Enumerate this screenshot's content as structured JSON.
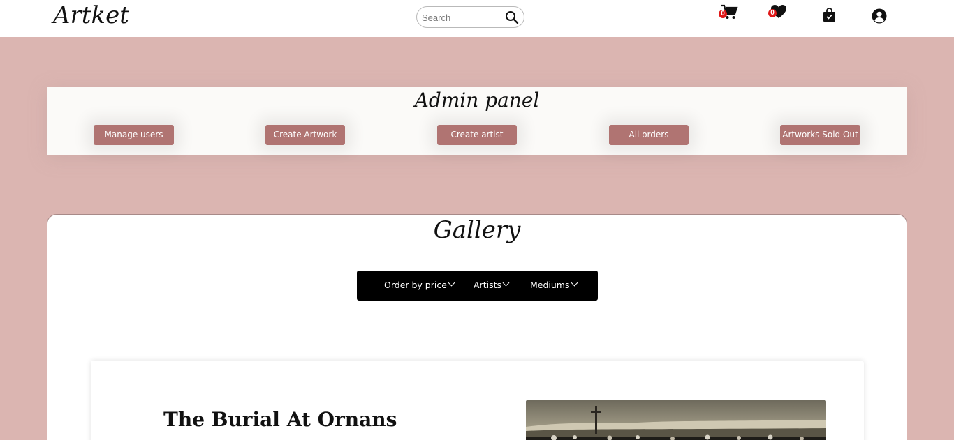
{
  "header": {
    "logo": "Artket",
    "search": {
      "placeholder": "Search",
      "value": ""
    },
    "cart_count": "0",
    "wishlist_count": "0"
  },
  "admin_panel": {
    "title": "Admin panel",
    "buttons": [
      "Manage users",
      "Create Artwork",
      "Create artist",
      "All orders",
      "Artworks Sold Out"
    ]
  },
  "gallery": {
    "title": "Gallery",
    "filters": [
      "Order by price",
      "Artists",
      "Mediums"
    ],
    "artwork": {
      "title": "The Burial At Ornans"
    }
  },
  "colors": {
    "page_background": "#dbb5b1",
    "admin_button": "#b07472",
    "filter_bar": "#000000",
    "badge": "#e01818"
  }
}
